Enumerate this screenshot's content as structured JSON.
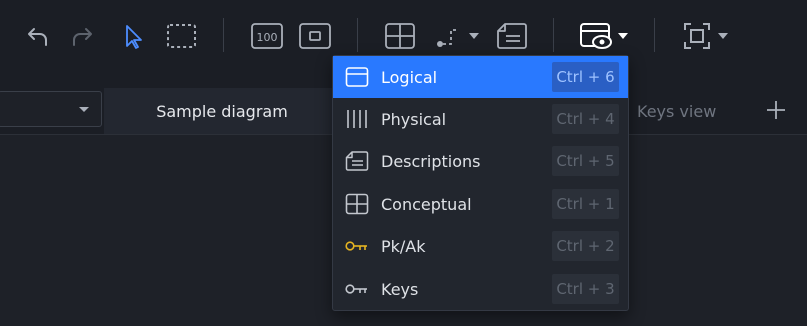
{
  "toolbar": {
    "icons": [
      "undo-icon",
      "redo-icon",
      "pointer-icon",
      "marquee-select-icon",
      "zoom-100-icon",
      "fit-to-screen-icon",
      "table-icon",
      "line-icon",
      "note-icon",
      "display-mode-icon",
      "capture-icon"
    ],
    "zoom_label": "100"
  },
  "tabs": {
    "active_label": "Sample diagram",
    "other_label": "Keys view",
    "add_label": "+"
  },
  "menu": {
    "items": [
      {
        "label": "Logical",
        "shortcut": "Ctrl + 6",
        "icon": "logical-icon",
        "selected": true
      },
      {
        "label": "Physical",
        "shortcut": "Ctrl + 4",
        "icon": "physical-icon",
        "selected": false
      },
      {
        "label": "Descriptions",
        "shortcut": "Ctrl + 5",
        "icon": "descriptions-icon",
        "selected": false
      },
      {
        "label": "Conceptual",
        "shortcut": "Ctrl + 1",
        "icon": "conceptual-icon",
        "selected": false
      },
      {
        "label": "Pk/Ak",
        "shortcut": "Ctrl + 2",
        "icon": "pk-ak-key-icon",
        "selected": false
      },
      {
        "label": "Keys",
        "shortcut": "Ctrl + 3",
        "icon": "keys-icon",
        "selected": false
      }
    ]
  },
  "colors": {
    "accent": "#2979ff",
    "key_gold": "#e6b422",
    "background": "#1e2128"
  }
}
